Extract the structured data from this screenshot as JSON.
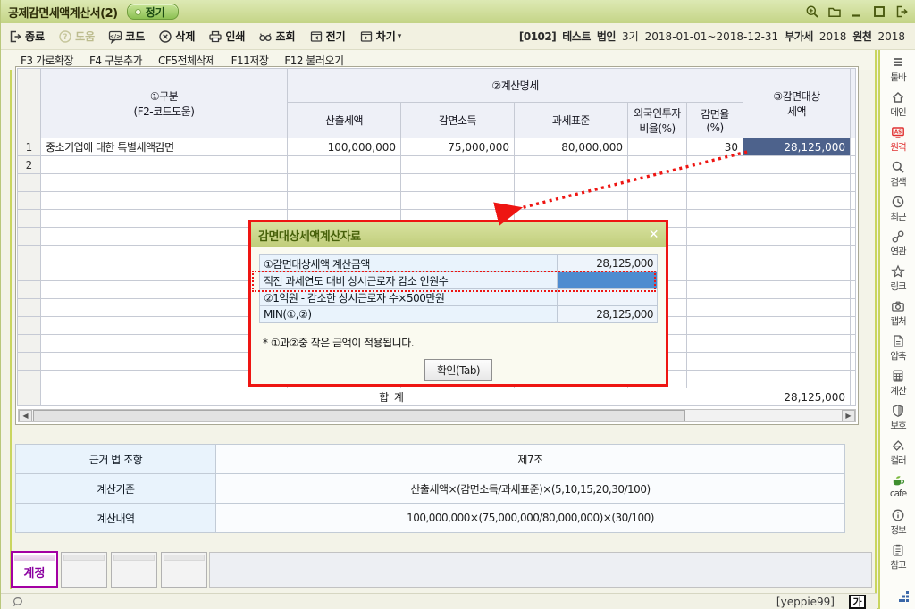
{
  "window": {
    "title": "공제감면세액계산서(2)",
    "badge": "정기",
    "controls": [
      {
        "name": "zoom-icon",
        "sym": "s-zoomp"
      },
      {
        "name": "folder-icon",
        "sym": "s-folder"
      },
      {
        "name": "minimize-icon",
        "sym": "s-min"
      },
      {
        "name": "maximize-icon",
        "sym": "s-max"
      },
      {
        "name": "exit-window-icon",
        "sym": "s-exit"
      }
    ]
  },
  "toolbar": {
    "buttons": [
      {
        "label": "종료",
        "icon": "exit-door-icon",
        "sym": "s-exit",
        "disabled": false
      },
      {
        "label": "도움",
        "icon": "help-icon",
        "sym": "s-help",
        "disabled": true
      },
      {
        "label": "코드",
        "icon": "code-icon",
        "sym": "s-code",
        "disabled": false
      },
      {
        "label": "삭제",
        "icon": "delete-icon",
        "sym": "s-del",
        "disabled": false
      },
      {
        "label": "인쇄",
        "icon": "print-icon",
        "sym": "s-print",
        "disabled": false
      },
      {
        "label": "조회",
        "icon": "view-binoculars-icon",
        "sym": "s-view",
        "disabled": false
      },
      {
        "label": "전기",
        "icon": "calendar-prev-icon",
        "sym": "s-calprev",
        "disabled": false
      },
      {
        "label": "차기",
        "icon": "calendar-next-icon",
        "sym": "s-calnext",
        "disabled": false
      }
    ],
    "more_label": "▾",
    "context_segments": [
      {
        "text": "[0102]",
        "bold": true
      },
      {
        "text": "테스트",
        "bold": true
      },
      {
        "text": "법인",
        "bold": true
      },
      {
        "text": "3기",
        "bold": false
      },
      {
        "text": "2018-01-01~2018-12-31",
        "bold": false
      },
      {
        "text": "부가세",
        "bold": true
      },
      {
        "text": "2018",
        "bold": false
      },
      {
        "text": "원천",
        "bold": true
      },
      {
        "text": "2018",
        "bold": false
      }
    ]
  },
  "function_keys": [
    "F3 가로확장",
    "F4 구분추가",
    "CF5전체삭제",
    "F11저장",
    "F12 불러오기"
  ],
  "grid": {
    "headers": {
      "kubun": [
        "①구분",
        "(F2-코드도움)"
      ],
      "group": "②계산명세",
      "subs": [
        [
          "산출세액",
          ""
        ],
        [
          "감면소득",
          ""
        ],
        [
          "과세표준",
          ""
        ],
        [
          "외국인투자",
          "비율(%)"
        ],
        [
          "감면율",
          "(%)"
        ]
      ],
      "target": [
        "③감면대상",
        "세액"
      ]
    },
    "rows": [
      {
        "num": "1",
        "cells": [
          "중소기업에 대한 특별세액감면",
          "100,000,000",
          "75,000,000",
          "80,000,000",
          "",
          "30",
          "28,125,000"
        ],
        "selected_cell": 6
      },
      {
        "num": "2",
        "cells": [
          "",
          "",
          "",
          "",
          "",
          "",
          ""
        ],
        "selected_cell": -1
      }
    ],
    "empty_row_count": 12,
    "total_label": "합        계",
    "total_value": "28,125,000"
  },
  "popup": {
    "title": "감면대상세액계산자료",
    "close_label": "✕",
    "rows": [
      {
        "label": "①감면대상세액 계산금액",
        "value": "28,125,000",
        "input": false,
        "highlighted": false
      },
      {
        "label": "직전 과세연도 대비 상시근로자 감소 인원수",
        "value": "",
        "input": true,
        "highlighted": true
      },
      {
        "label": "②1억원 - 감소한 상시근로자 수×500만원",
        "value": "",
        "input": false,
        "highlighted": false
      },
      {
        "label": "MIN(①,②)",
        "value": "28,125,000",
        "input": false,
        "highlighted": false
      }
    ],
    "note": "* ①과②중 작은 금액이 적용됩니다.",
    "confirm_label": "확인(Tab)"
  },
  "info_table": {
    "rows": [
      {
        "label": "근거 법 조항",
        "value": "제7조"
      },
      {
        "label": "계산기준",
        "value": "산출세액×(감면소득/과세표준)×(5,10,15,20,30/100)"
      },
      {
        "label": "계산내역",
        "value": "100,000,000×(75,000,000/80,000,000)×(30/100)"
      }
    ]
  },
  "bottom_tabs": {
    "active_label": "계정",
    "empty_count": 3
  },
  "sidebar": {
    "items": [
      {
        "label": "툴바",
        "icon": "toolbar-menu-icon",
        "sym": "s-menu",
        "red": false
      },
      {
        "label": "메인",
        "icon": "home-icon",
        "sym": "s-home",
        "red": false
      },
      {
        "label": "원격",
        "icon": "remote-as-icon",
        "sym": "s-remote",
        "red": true
      },
      {
        "label": "검색",
        "icon": "search-icon",
        "sym": "s-search",
        "red": false
      },
      {
        "label": "최근",
        "icon": "recent-clock-icon",
        "sym": "s-clock",
        "red": false
      },
      {
        "label": "연관",
        "icon": "related-chain-icon",
        "sym": "s-chain",
        "red": false
      },
      {
        "label": "링크",
        "icon": "link-star-icon",
        "sym": "s-star",
        "red": false
      },
      {
        "label": "캡처",
        "icon": "capture-camera-icon",
        "sym": "s-camera",
        "red": false
      },
      {
        "label": "압축",
        "icon": "zip-document-icon",
        "sym": "s-doc",
        "red": false
      },
      {
        "label": "계산",
        "icon": "calculator-icon",
        "sym": "s-calc",
        "red": false
      },
      {
        "label": "보호",
        "icon": "shield-icon",
        "sym": "s-shield",
        "red": false
      },
      {
        "label": "컬러",
        "icon": "color-bucket-icon",
        "sym": "s-bucket",
        "red": false
      },
      {
        "label": "cafe",
        "icon": "cafe-cup-icon",
        "sym": "s-cup",
        "red": false
      },
      {
        "label": "정보",
        "icon": "info-icon",
        "sym": "s-info",
        "red": false
      },
      {
        "label": "참고",
        "icon": "reference-clipboard-icon",
        "sym": "s-clip",
        "red": false
      }
    ]
  },
  "status_bar": {
    "user": "[yeppie99]",
    "font_button_label": "가"
  }
}
